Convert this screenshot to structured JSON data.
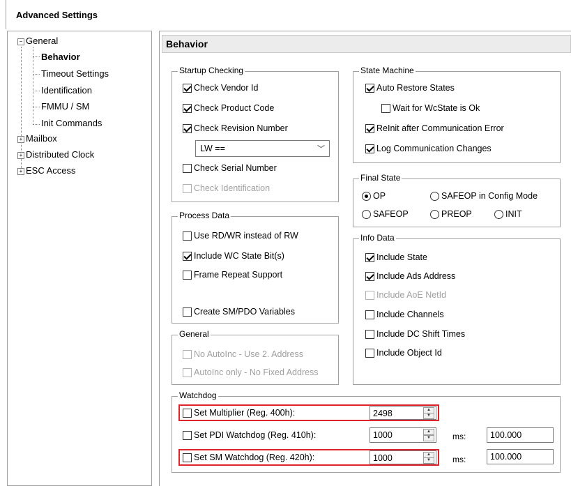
{
  "window": {
    "title": "Advanced Settings"
  },
  "tree": {
    "items": [
      {
        "label": "General",
        "expander": "⊟"
      },
      {
        "label": "Behavior"
      },
      {
        "label": "Timeout Settings"
      },
      {
        "label": "Identification"
      },
      {
        "label": "FMMU / SM"
      },
      {
        "label": "Init Commands"
      },
      {
        "label": "Mailbox",
        "expander": "⊞"
      },
      {
        "label": "Distributed Clock",
        "expander": "⊞"
      },
      {
        "label": "ESC Access",
        "expander": "⊞"
      }
    ]
  },
  "section": {
    "title": "Behavior"
  },
  "startup_checking": {
    "title": "Startup Checking",
    "check_vendor_id": "Check Vendor Id",
    "check_product_code": "Check Product Code",
    "check_revision_number": "Check Revision Number",
    "revision_compare": "LW ==",
    "check_serial_number": "Check Serial Number",
    "check_identification": "Check Identification"
  },
  "state_machine": {
    "title": "State Machine",
    "auto_restore_states": "Auto Restore States",
    "wait_for_wcstate": "Wait for WcState is Ok",
    "reinit_after_error": "ReInit after Communication Error",
    "log_comm_changes": "Log Communication Changes"
  },
  "final_state": {
    "title": "Final State",
    "op": "OP",
    "safeop_config": "SAFEOP in Config Mode",
    "safeop": "SAFEOP",
    "preop": "PREOP",
    "init": "INIT"
  },
  "process_data": {
    "title": "Process Data",
    "use_rdwr": "Use RD/WR instead of RW",
    "include_wc_state": "Include WC State Bit(s)",
    "frame_repeat": "Frame Repeat Support",
    "create_sm_pdo": "Create SM/PDO Variables"
  },
  "info_data": {
    "title": "Info Data",
    "include_state": "Include State",
    "include_ads_address": "Include Ads Address",
    "include_aoe_netid": "Include AoE NetId",
    "include_channels": "Include Channels",
    "include_dc_shift": "Include DC Shift Times",
    "include_object_id": "Include Object Id"
  },
  "general": {
    "title": "General",
    "no_autoinc": "No AutoInc - Use 2. Address",
    "autoinc_only": "AutoInc only - No Fixed Address"
  },
  "watchdog": {
    "title": "Watchdog",
    "set_multiplier": "Set Multiplier (Reg. 400h):",
    "multiplier_value": "2498",
    "set_pdi": "Set PDI Watchdog (Reg. 410h):",
    "pdi_value": "1000",
    "pdi_unit": "ms:",
    "pdi_ms": "100.000",
    "set_sm": "Set SM Watchdog (Reg. 420h):",
    "sm_value": "1000",
    "sm_unit": "ms:",
    "sm_ms": "100.000"
  },
  "colors": {
    "highlight": "#e0242c",
    "header_bg": "#ececec"
  }
}
